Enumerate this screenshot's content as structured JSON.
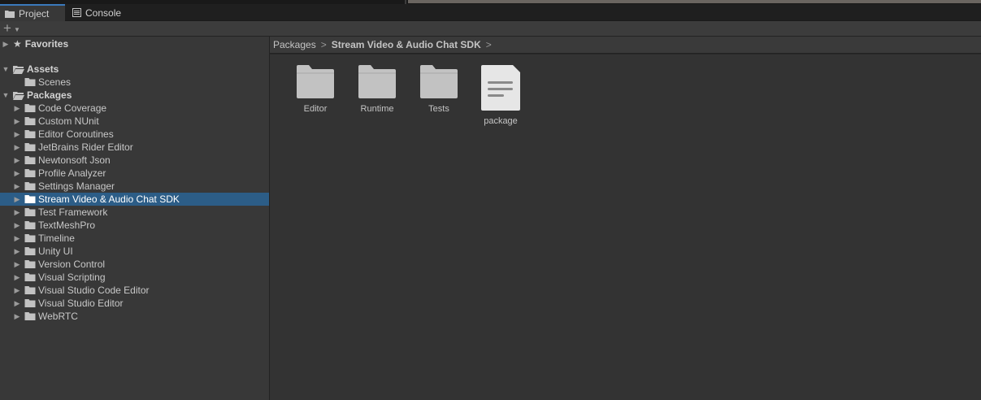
{
  "tabs": [
    {
      "label": "Project",
      "icon": "folder-icon",
      "active": true
    },
    {
      "label": "Console",
      "icon": "console-icon",
      "active": false
    }
  ],
  "toolbar": {
    "create_icon": "plus-icon"
  },
  "tree": {
    "favorites": "Favorites",
    "assets": "Assets",
    "scenes": "Scenes",
    "packages": "Packages",
    "package_items": [
      "Code Coverage",
      "Custom NUnit",
      "Editor Coroutines",
      "JetBrains Rider Editor",
      "Newtonsoft Json",
      "Profile Analyzer",
      "Settings Manager",
      "Stream Video & Audio Chat SDK",
      "Test Framework",
      "TextMeshPro",
      "Timeline",
      "Unity UI",
      "Version Control",
      "Visual Scripting",
      "Visual Studio Code Editor",
      "Visual Studio Editor",
      "WebRTC"
    ],
    "selected_item": "Stream Video & Audio Chat SDK"
  },
  "breadcrumb": [
    "Packages",
    "Stream Video & Audio Chat SDK"
  ],
  "assets": [
    {
      "label": "Editor",
      "type": "folder"
    },
    {
      "label": "Runtime",
      "type": "folder"
    },
    {
      "label": "Tests",
      "type": "folder"
    },
    {
      "label": "package",
      "type": "file"
    }
  ],
  "colors": {
    "selection": "#2c5d87",
    "tab_accent": "#3a79bb",
    "folder": "#c2c2c2"
  }
}
